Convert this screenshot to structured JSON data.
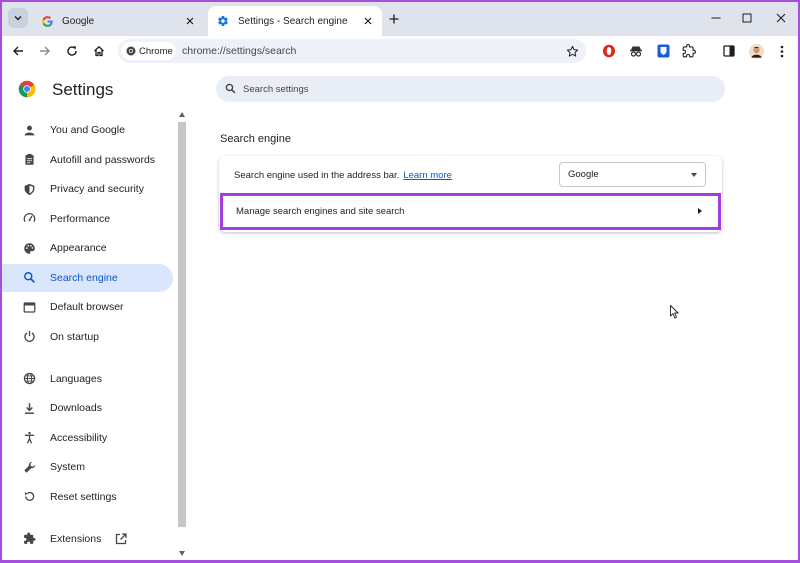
{
  "tabs": [
    {
      "label": "Google",
      "favicon": "google-g-icon",
      "active": false
    },
    {
      "label": "Settings - Search engine",
      "favicon": "settings-gear-icon",
      "active": true
    }
  ],
  "toolbar": {
    "chip_label": "Chrome",
    "url": "chrome://settings/search"
  },
  "settings": {
    "title": "Settings",
    "search_placeholder": "Search settings"
  },
  "sidebar": {
    "items": [
      {
        "label": "You and Google",
        "icon": "person-icon"
      },
      {
        "label": "Autofill and passwords",
        "icon": "clipboard-icon"
      },
      {
        "label": "Privacy and security",
        "icon": "shield-icon"
      },
      {
        "label": "Performance",
        "icon": "speedometer-icon"
      },
      {
        "label": "Appearance",
        "icon": "palette-icon"
      },
      {
        "label": "Search engine",
        "icon": "search-icon",
        "selected": true
      },
      {
        "label": "Default browser",
        "icon": "browser-window-icon"
      },
      {
        "label": "On startup",
        "icon": "power-icon"
      },
      {
        "label": "Languages",
        "icon": "globe-icon"
      },
      {
        "label": "Downloads",
        "icon": "download-icon"
      },
      {
        "label": "Accessibility",
        "icon": "accessibility-icon"
      },
      {
        "label": "System",
        "icon": "wrench-icon"
      },
      {
        "label": "Reset settings",
        "icon": "reset-icon"
      },
      {
        "label": "Extensions",
        "icon": "puzzle-icon"
      }
    ]
  },
  "search_engine_section": {
    "title": "Search engine",
    "address_bar_text": "Search engine used in the address bar.",
    "learn_more": "Learn more",
    "selected_engine": "Google",
    "manage_label": "Manage search engines and site search"
  },
  "colors": {
    "highlight_border": "#a13ee0",
    "selected_bg": "#d9e6fb",
    "accent": "#0b57d0",
    "frame": "#a54ddc"
  }
}
